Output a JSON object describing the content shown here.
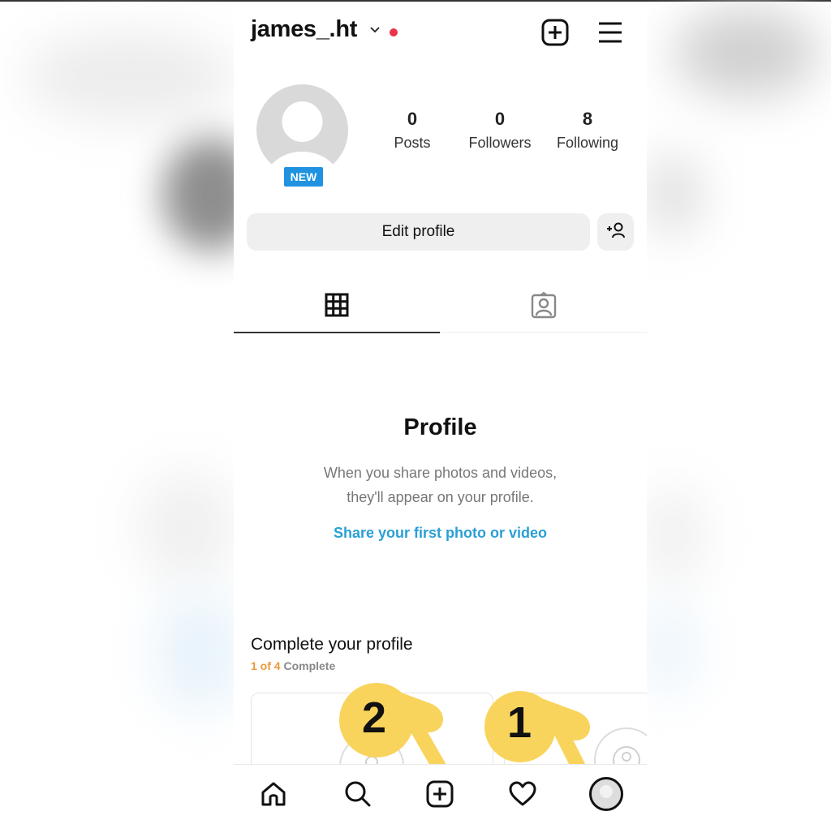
{
  "header": {
    "username": "james_.ht",
    "notification_dot_color": "#e8334a"
  },
  "profile": {
    "badge": "NEW",
    "stats": [
      {
        "value": "0",
        "label": "Posts"
      },
      {
        "value": "0",
        "label": "Followers"
      },
      {
        "value": "8",
        "label": "Following"
      }
    ],
    "edit_button": "Edit profile"
  },
  "tabs": [
    {
      "name": "grid",
      "icon": "grid-icon",
      "active": true
    },
    {
      "name": "tagged",
      "icon": "tagged-person-icon",
      "active": false
    }
  ],
  "empty_state": {
    "title": "Profile",
    "text_line1": "When you share photos and videos,",
    "text_line2": "they'll appear on your profile.",
    "link": "Share your first photo or video"
  },
  "complete_profile": {
    "title": "Complete your profile",
    "progress_text": "1 of 4",
    "suffix": " Complete",
    "completed": 1,
    "total": 4
  },
  "bottom_nav": [
    {
      "name": "home",
      "icon": "home-icon"
    },
    {
      "name": "search",
      "icon": "search-icon"
    },
    {
      "name": "create",
      "icon": "plus-square-icon"
    },
    {
      "name": "activity",
      "icon": "heart-icon"
    },
    {
      "name": "profile",
      "icon": "avatar-icon"
    }
  ],
  "annotations": [
    {
      "label": "1",
      "target": "profile"
    },
    {
      "label": "2",
      "target": "create"
    }
  ],
  "colors": {
    "badge": "#1f93e0",
    "link": "#2a9fd6",
    "progress": "#e89a3c",
    "pointer": "#f9d45c"
  }
}
